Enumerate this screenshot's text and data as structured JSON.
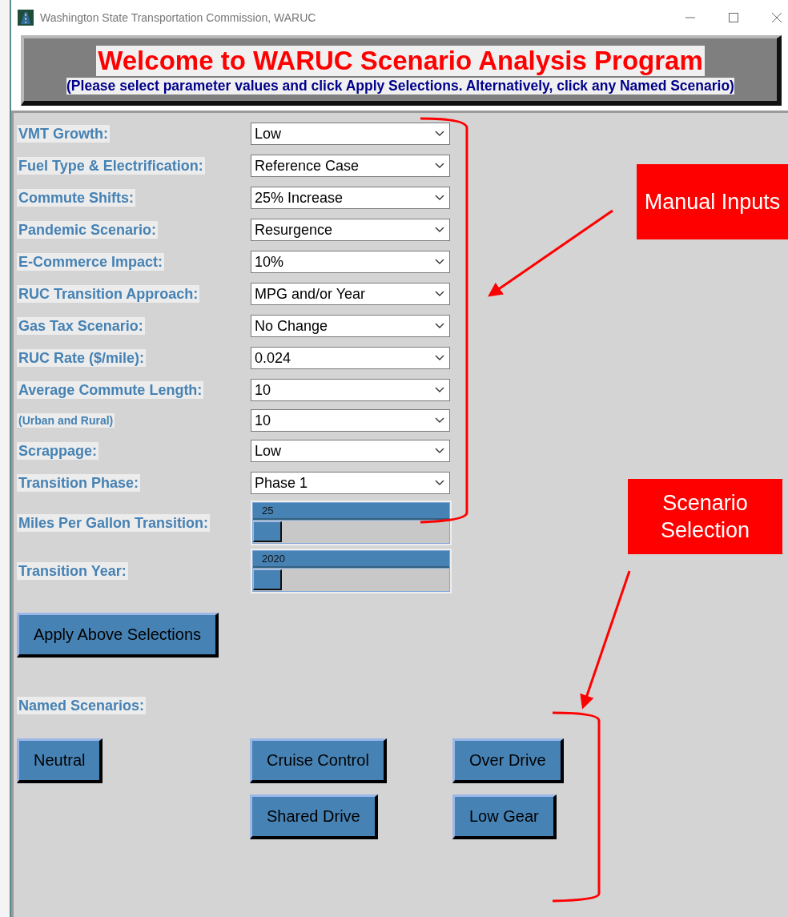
{
  "window": {
    "title": "Washington State Transportation Commission, WARUC"
  },
  "header": {
    "title": "Welcome to WARUC Scenario Analysis Program",
    "subtitle": "(Please select parameter values and click Apply Selections. Alternatively, click any Named Scenario)"
  },
  "parameters": [
    {
      "kind": "dropdown",
      "label": "VMT Growth:",
      "value": "Low"
    },
    {
      "kind": "dropdown",
      "label": "Fuel Type & Electrification:",
      "value": "Reference Case"
    },
    {
      "kind": "dropdown",
      "label": "Commute Shifts:",
      "value": "25% Increase"
    },
    {
      "kind": "dropdown",
      "label": "Pandemic Scenario:",
      "value": "Resurgence"
    },
    {
      "kind": "dropdown",
      "label": "E-Commerce Impact:",
      "value": "10%"
    },
    {
      "kind": "dropdown",
      "label": "RUC Transition Approach:",
      "value": "MPG and/or Year"
    },
    {
      "kind": "dropdown",
      "label": "Gas Tax Scenario:",
      "value": "No Change"
    },
    {
      "kind": "dropdown",
      "label": "RUC Rate ($/mile):",
      "value": "0.024"
    },
    {
      "kind": "dropdown",
      "label": "Average Commute Length:",
      "value": "10"
    },
    {
      "kind": "note",
      "label": "(Urban and Rural)",
      "value": "10"
    },
    {
      "kind": "dropdown",
      "label": "Scrappage:",
      "value": "Low"
    },
    {
      "kind": "dropdown",
      "label": "Transition Phase:",
      "value": "Phase 1"
    },
    {
      "kind": "slider",
      "label": "Miles Per Gallon Transition:",
      "value": "25",
      "level": 0
    },
    {
      "kind": "slider",
      "label": "Transition Year:",
      "value": "2020",
      "level": 0
    }
  ],
  "apply_button": "Apply Above Selections",
  "named_scenarios": {
    "label": "Named Scenarios:",
    "buttons": [
      [
        "Neutral",
        "Cruise Control",
        "Over Drive"
      ],
      [
        "Shared Drive",
        "Low Gear"
      ]
    ]
  },
  "annotations": [
    {
      "text": "Manual Inputs"
    },
    {
      "text": "Scenario Selection"
    }
  ]
}
